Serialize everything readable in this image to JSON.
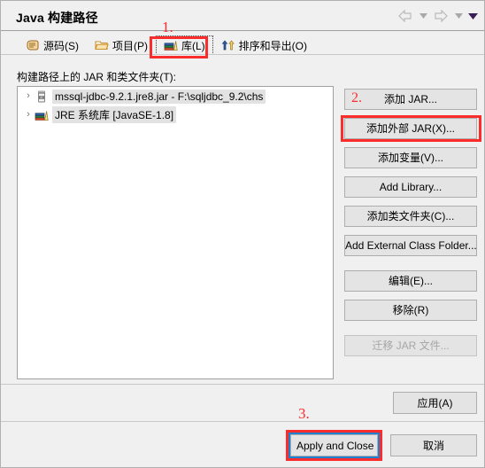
{
  "window": {
    "title": "Java 构建路径"
  },
  "nav": {
    "back_icon": "back-arrow-icon",
    "back_caret_icon": "chevron-down-icon",
    "forward_icon": "forward-arrow-icon",
    "forward_caret_icon": "chevron-down-icon",
    "menu_caret_icon": "chevron-down-icon"
  },
  "tabs": [
    {
      "label": "源码(S)",
      "icon": "source-package-icon",
      "selected": false
    },
    {
      "label": "项目(P)",
      "icon": "project-folder-icon",
      "selected": false
    },
    {
      "label": "库(L)",
      "icon": "libraries-books-icon",
      "selected": true
    },
    {
      "label": "排序和导出(O)",
      "icon": "order-export-arrows-icon",
      "selected": false
    }
  ],
  "content": {
    "list_label": "构建路径上的 JAR 和类文件夹(T):",
    "items": [
      {
        "expander": "›",
        "icon": "jar-file-icon",
        "label": "mssql-jdbc-9.2.1.jre8.jar - F:\\sqljdbc_9.2\\chs"
      },
      {
        "expander": "›",
        "icon": "jre-library-icon",
        "label": "JRE 系统库 [JavaSE-1.8]"
      }
    ]
  },
  "side_buttons": [
    {
      "key": "add_jar",
      "label": "添加 JAR...",
      "mnemonic": "J",
      "disabled": false
    },
    {
      "key": "add_external_jar",
      "label": "添加外部 JAR(X)...",
      "mnemonic": "X",
      "disabled": false
    },
    {
      "key": "add_variable",
      "label": "添加变量(V)...",
      "mnemonic": "V",
      "disabled": false
    },
    {
      "key": "add_library",
      "label": "Add Library...",
      "mnemonic": "i",
      "disabled": false
    },
    {
      "key": "add_class_folder",
      "label": "添加类文件夹(C)...",
      "mnemonic": "C",
      "disabled": false
    },
    {
      "key": "add_external_class",
      "label": "Add External Class Folder...",
      "mnemonic": "d",
      "disabled": false
    },
    {
      "key": "edit",
      "label": "编辑(E)...",
      "mnemonic": "E",
      "disabled": false
    },
    {
      "key": "remove",
      "label": "移除(R)",
      "mnemonic": "R",
      "disabled": false
    },
    {
      "key": "migrate_jar",
      "label": "迁移 JAR 文件...",
      "mnemonic": "",
      "disabled": true
    }
  ],
  "footer": {
    "apply_label": "应用(A)",
    "apply_and_close_label": "Apply and Close",
    "cancel_label": "取消"
  },
  "annotations": {
    "step1": "1.",
    "step2": "2.",
    "step3": "3.",
    "color": "#fb2c2c"
  }
}
